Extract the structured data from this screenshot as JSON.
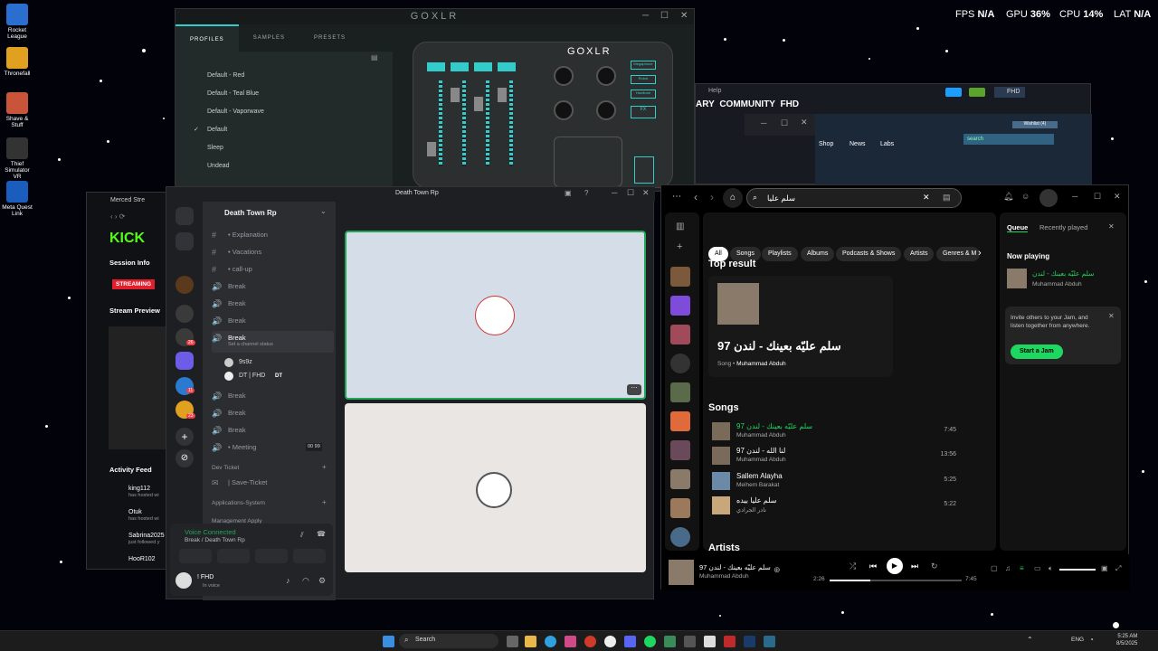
{
  "desktop": {
    "icons": [
      "Rocket League",
      "Thronefall",
      "Shave & Stuff",
      "Thief Simulator VR",
      "Meta Quest Link"
    ]
  },
  "overlay": {
    "fps_label": "FPS",
    "fps": "N/A",
    "gpu_label": "GPU",
    "gpu": "36",
    "cpu_label": "CPU",
    "cpu": "14",
    "lat_label": "LAT",
    "lat": "N/A",
    "pct": "%"
  },
  "goxlr": {
    "title": "GOXLR",
    "tabs": [
      "PROFILES",
      "SAMPLES",
      "PRESETS"
    ],
    "profiles": [
      "Default - Red",
      "Default - Teal Blue",
      "Default - Vaporwave",
      "Default",
      "Sleep",
      "Undead"
    ],
    "active_profile": "Default",
    "check": "✓",
    "mixer_logo": "GOXLR",
    "effect_buttons": [
      "Megaphone",
      "Robot",
      "Hardtune",
      "FX"
    ],
    "knob_labels": [
      "Reverb",
      "Pitch",
      "Echo",
      "Gender"
    ]
  },
  "bgwindow": {
    "menu": [
      "Help"
    ],
    "nav": [
      "ARY",
      "COMMUNITY",
      "FHD"
    ],
    "links": [
      "Shop",
      "News",
      "Labs"
    ],
    "search_placeholder": "search",
    "wishlist": "Wishlist (4)",
    "user": "FHD"
  },
  "browser": {
    "tab": "Merced Stre",
    "kick": "KICK",
    "session_info": "Session Info",
    "status": "STREAMING",
    "stream_preview": "Stream Preview",
    "activity_title": "Activity Feed",
    "activity": [
      {
        "name": "king112",
        "text": "has hosted wi"
      },
      {
        "name": "Otuk",
        "text": "has hosted wi"
      },
      {
        "name": "Sabrina2025",
        "text": "just followed y"
      },
      {
        "name": "HooR102",
        "text": ""
      }
    ]
  },
  "discord": {
    "window_title": "Death Town Rp",
    "server": "Death Town Rp",
    "channels": [
      {
        "icon": "#",
        "label": "• Explanation"
      },
      {
        "icon": "#",
        "label": "• Vacations"
      },
      {
        "icon": "#",
        "label": "• call-up"
      },
      {
        "icon": "🔊",
        "label": "Break"
      },
      {
        "icon": "🔊",
        "label": "Break"
      },
      {
        "icon": "🔊",
        "label": "Break"
      },
      {
        "icon": "🔊",
        "label": "Break"
      }
    ],
    "channel_status": "Set a channel status",
    "voice_users": [
      "9s9z",
      "DT | FHD"
    ],
    "dt_tag": "DT",
    "channels2": [
      {
        "icon": "🔊",
        "label": "Break"
      },
      {
        "icon": "🔊",
        "label": "Break"
      },
      {
        "icon": "🔊",
        "label": "Break"
      },
      {
        "icon": "🔊",
        "label": "• Meeting"
      }
    ],
    "meeting_count": "00",
    "meeting_limit": "99",
    "category": "Dev Ticket",
    "save_ticket": "| Save-Ticket",
    "apps_system": "Applications-System",
    "more_category": "Management Apply",
    "server_badges": [
      "26",
      "11",
      "23"
    ],
    "voice_connected": "Voice Connected",
    "voice_channel": "Break / Death Town Rp",
    "user_name": "! FHD",
    "user_status": "In voice"
  },
  "spotify": {
    "search": "سلم عليا",
    "filters": [
      "All",
      "Songs",
      "Playlists",
      "Albums",
      "Podcasts & Shows",
      "Artists",
      "Genres & M"
    ],
    "top_result_title": "Top result",
    "top_name": "سلم عليّه بعينك - لندن 97",
    "top_type": "Song",
    "top_artist": "Muhammad Abduh",
    "songs_title": "Songs",
    "songs": [
      {
        "title": "سلم عليّه بعينك - لندن 97",
        "artist": "Muhammad Abduh",
        "duration": "7:45",
        "active": true
      },
      {
        "title": "لنا الله - لندن 97",
        "artist": "Muhammad Abduh",
        "duration": "13:56"
      },
      {
        "title": "Sallem Alayha",
        "artist": "Melhem Barakat",
        "duration": "5:25"
      },
      {
        "title": "سلم عليا بيده",
        "artist": "نادر الجرادي",
        "duration": "5:22"
      }
    ],
    "artists_title": "Artists",
    "queue_tab": "Queue",
    "recent_tab": "Recently played",
    "now_playing": "Now playing",
    "np_title": "سلم عليّه بعينك - لندن",
    "np_artist": "Muhammad Abduh",
    "jam_text": "Invite others to your Jam, and listen together from anywhere.",
    "jam_button": "Start a Jam",
    "player_title": "سلم عليّه بعينك - لندن 97",
    "player_artist": "Muhammad Abduh",
    "elapsed": "2:26",
    "total": "7:45",
    "progress": 0.31
  },
  "taskbar": {
    "search": "Search",
    "lang": "ENG",
    "time": "5:25 AM",
    "date": "8/5/2025"
  },
  "colors": {
    "spotify_green": "#1ed760",
    "goxlr_teal": "#3cc",
    "discord_bg": "#1e1f22"
  }
}
